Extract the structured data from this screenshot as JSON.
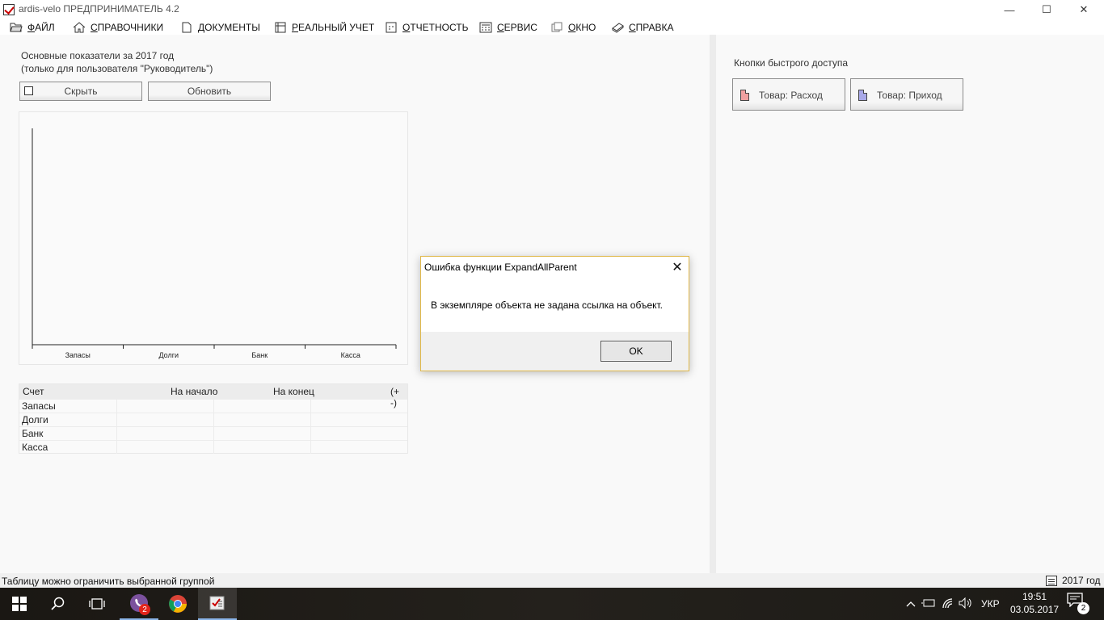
{
  "window": {
    "title": "ardis-velo  ПРЕДПРИНИМАТЕЛЬ 4.2",
    "controls": {
      "minimize": "—",
      "maximize": "☐",
      "close": "✕"
    }
  },
  "menu": [
    {
      "first": "Ф",
      "rest": "АЙЛ",
      "icon": "folder-open-icon"
    },
    {
      "first": "С",
      "rest": "ПРАВОЧНИКИ",
      "icon": "home-icon"
    },
    {
      "first": "Д",
      "rest": "ОКУМЕНТЫ",
      "icon": "document-icon"
    },
    {
      "first": "Р",
      "rest": "ЕАЛЬНЫЙ УЧЕТ",
      "icon": "ledger-icon"
    },
    {
      "first": "О",
      "rest": "ТЧЕТНОСТЬ",
      "icon": "report-icon"
    },
    {
      "first": "С",
      "rest": "ЕРВИС",
      "icon": "calculator-icon"
    },
    {
      "first": "О",
      "rest": "КНО",
      "icon": "window-icon"
    },
    {
      "first": "С",
      "rest": "ПРАВКА",
      "icon": "help-book-icon"
    }
  ],
  "kpi": {
    "title_line1": "Основные показатели за 2017 год",
    "title_line2": "(только для пользователя \"Руководитель\")",
    "hide_label": "Скрыть",
    "refresh_label": "Обновить"
  },
  "chart_data": {
    "type": "bar",
    "categories": [
      "Запасы",
      "Долги",
      "Банк",
      "Касса"
    ],
    "values": [
      null,
      null,
      null,
      null
    ]
  },
  "accounts_table": {
    "headers": [
      "Счет",
      "На начало",
      "На конец",
      "(+ -)"
    ],
    "rows": [
      "Запасы",
      "Долги",
      "Банк",
      "Касса"
    ]
  },
  "quick_access": {
    "title": "Кнопки быстрого доступа",
    "expense_label": "Товар: Расход",
    "income_label": "Товар: Приход"
  },
  "status": {
    "hint": "Таблицу можно ограничить выбранной группой",
    "year": "2017 год"
  },
  "dialog": {
    "title": "Ошибка функции ExpandAllParent",
    "message": "В экземпляре объекта не задана ссылка на объект.",
    "ok_label": "OK",
    "close_glyph": "✕"
  },
  "taskbar": {
    "viber_badge": "2",
    "lang": "УКР",
    "time": "19:51",
    "date": "03.05.2017",
    "notifications": "2"
  },
  "colors": {
    "dialog_border": "#e0b84a",
    "expense_doc": "#f0a0a0",
    "income_doc": "#a8a8e8",
    "taskbar_accent": "#8ab4e8"
  }
}
